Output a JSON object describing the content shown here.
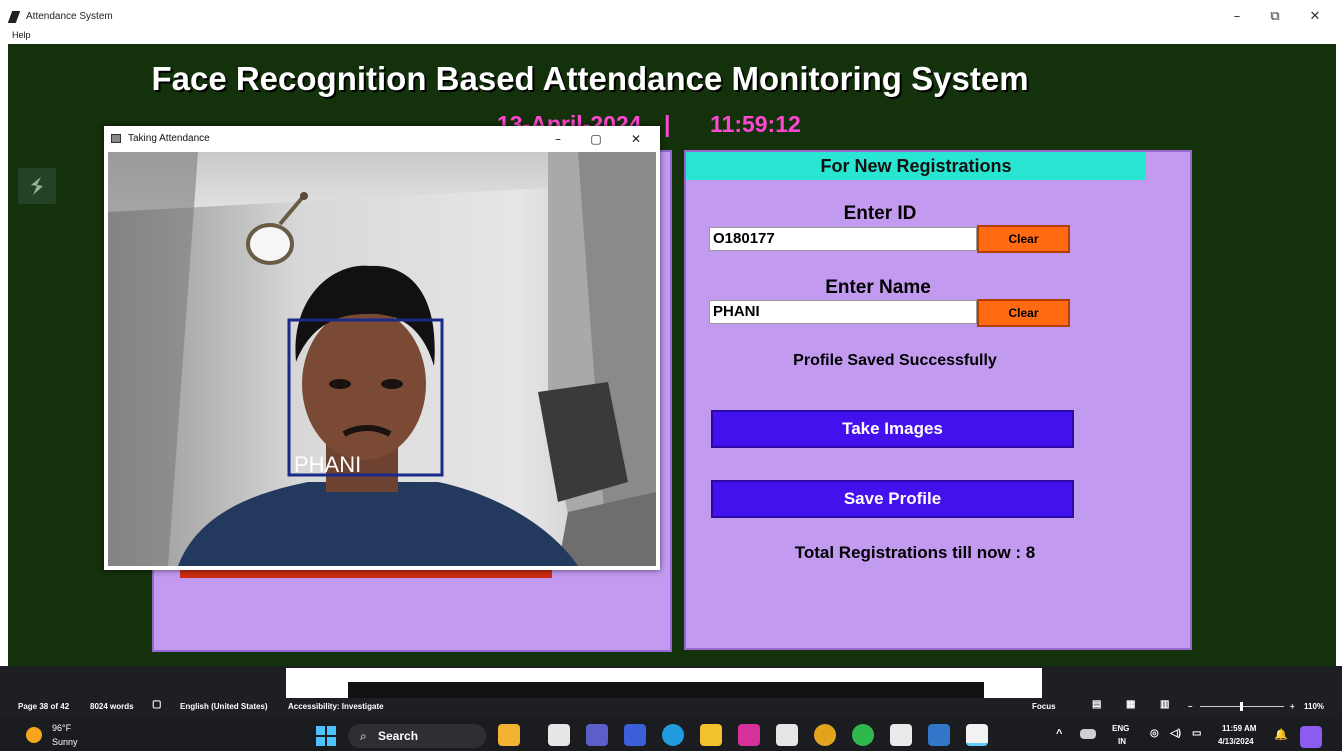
{
  "window": {
    "title": "Attendance System",
    "menu": [
      "Help"
    ]
  },
  "header": {
    "title": "Face Recognition Based Attendance Monitoring System",
    "date": "13-April-2024",
    "separator": "|",
    "time": "11:59:12"
  },
  "camera_window": {
    "title": "Taking Attendance",
    "face_label": "PHANI"
  },
  "registration": {
    "header": "For New Registrations",
    "id_label": "Enter ID",
    "id_value": "O180177",
    "name_label": "Enter Name",
    "name_value": "PHANI",
    "clear_label": "Clear",
    "status_message": "Profile Saved Successfully",
    "take_images_label": "Take Images",
    "save_profile_label": "Save Profile",
    "total_text": "Total Registrations till now  : 8"
  },
  "word_statusbar": {
    "page": "Page 38 of 42",
    "words": "8024 words",
    "language": "English (United States)",
    "accessibility": "Accessibility: Investigate",
    "focus": "Focus",
    "zoom": "110%"
  },
  "taskbar": {
    "weather_temp": "96°F",
    "weather_desc": "Sunny",
    "search_label": "Search",
    "lang_top": "ENG",
    "lang_bottom": "IN",
    "clock_time": "11:59 AM",
    "clock_date": "4/13/2024"
  },
  "colors": {
    "app_background": "#13310a",
    "panel": "#c29af0",
    "header_bar": "#28e6d2",
    "clear_button": "#ff6a12",
    "action_button": "#4310ee",
    "date_text": "#ff47d4",
    "face_box": "#1a2a8a"
  }
}
